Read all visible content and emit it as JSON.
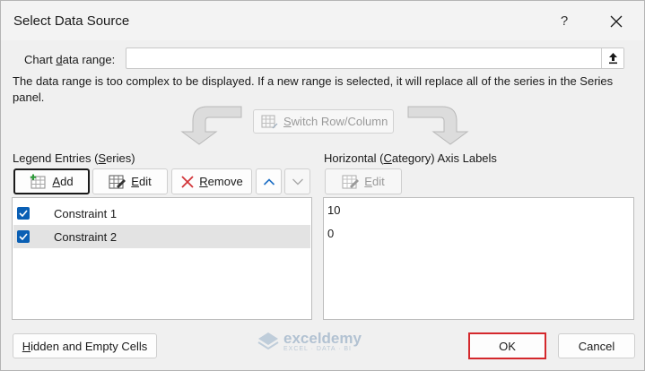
{
  "window": {
    "title": "Select Data Source",
    "help_label": "?",
    "close_label": "close"
  },
  "chart_range": {
    "label_pre": "Chart ",
    "label_ul": "d",
    "label_post": "ata range:",
    "value": ""
  },
  "notice": "The data range is too complex to be displayed. If a new range is selected, it will replace all of the series in the Series panel.",
  "switch": {
    "label_ul": "S",
    "label_post": "witch Row/Column",
    "enabled": false
  },
  "legend": {
    "title_pre": "Legend Entries (",
    "title_ul": "S",
    "title_post": "eries)",
    "add_ul": "A",
    "add_post": "dd",
    "edit_ul": "E",
    "edit_post": "dit",
    "remove_ul": "R",
    "remove_post": "emove",
    "series": [
      {
        "label": "Constraint 1",
        "checked": true,
        "selected": false
      },
      {
        "label": "Constraint 2",
        "checked": true,
        "selected": true
      }
    ]
  },
  "axis": {
    "title_pre": "Horizontal (",
    "title_ul": "C",
    "title_post": "ategory) Axis Labels",
    "edit_ul": "E",
    "edit_post": "dit",
    "labels": [
      "10",
      "0"
    ]
  },
  "footer": {
    "hidden_ul": "H",
    "hidden_post": "idden and Empty Cells",
    "ok_label": "OK",
    "cancel_label": "Cancel"
  },
  "watermark": {
    "name": "exceldemy",
    "tagline": "EXCEL · DATA · BI"
  },
  "colors": {
    "accent_checkbox": "#0a5fb4",
    "ok_highlight": "#d4282c",
    "remove_icon": "#d13438",
    "arrow_up": "#1e6fc5"
  }
}
